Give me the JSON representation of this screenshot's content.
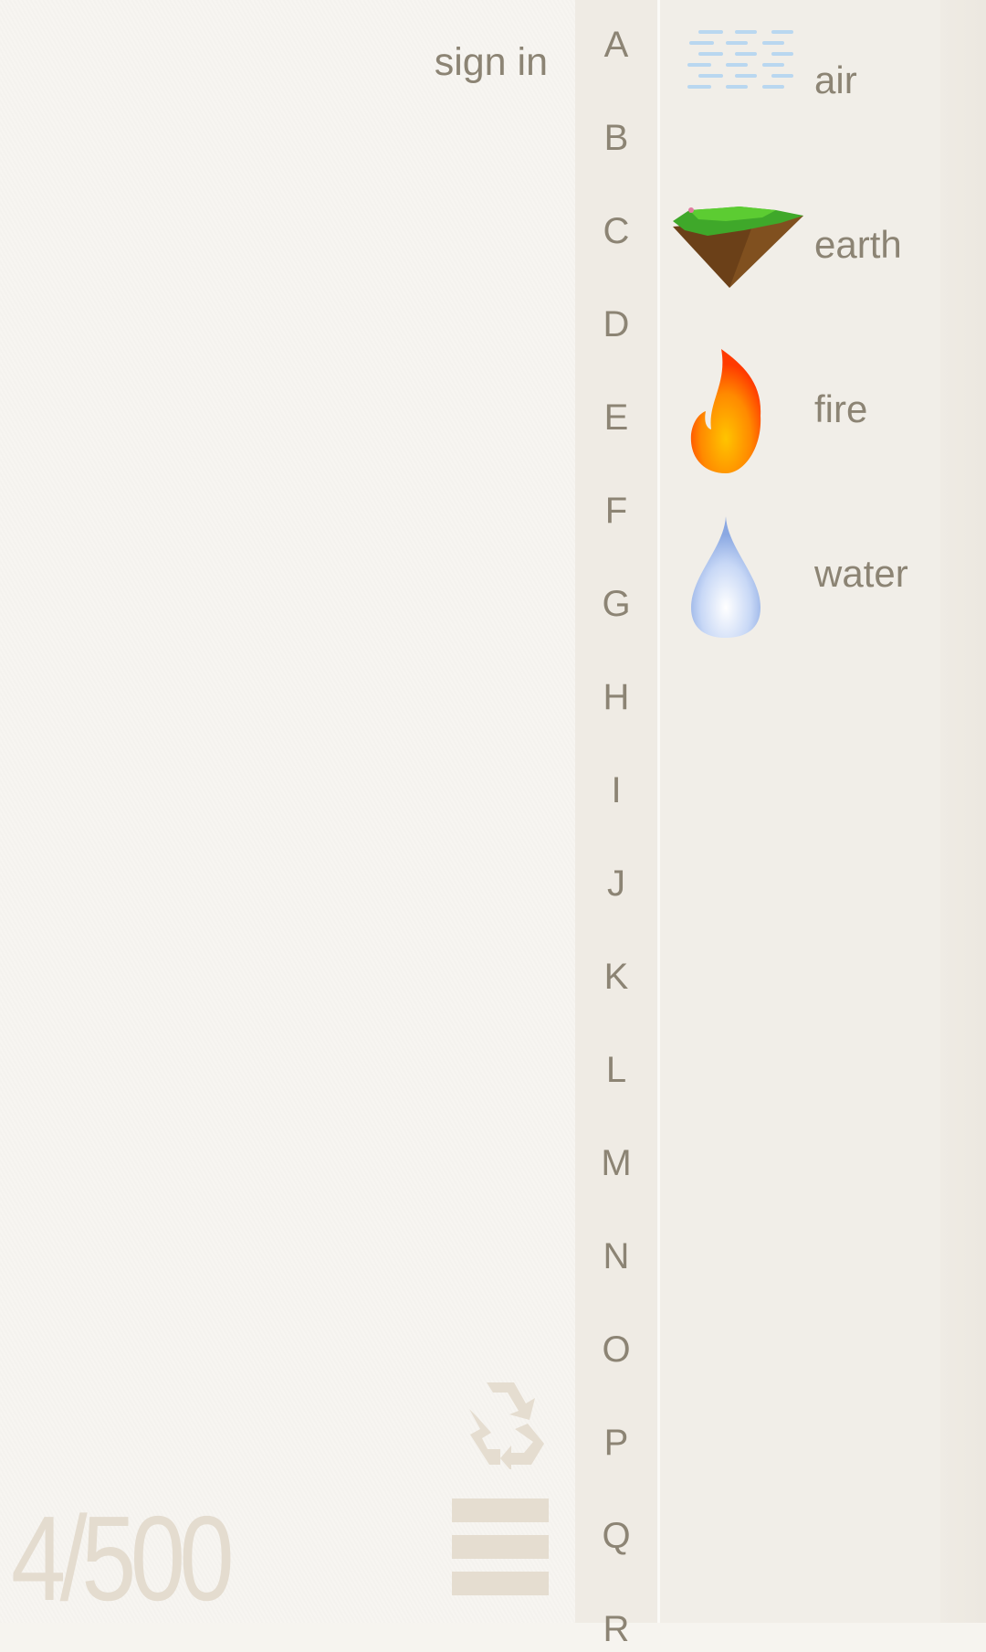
{
  "header": {
    "sign_in_label": "sign in"
  },
  "alphabet": [
    "A",
    "B",
    "C",
    "D",
    "E",
    "F",
    "G",
    "H",
    "I",
    "J",
    "K",
    "L",
    "M",
    "N",
    "O",
    "P",
    "Q",
    "R"
  ],
  "elements": [
    {
      "name": "air",
      "icon": "air-icon"
    },
    {
      "name": "earth",
      "icon": "earth-icon"
    },
    {
      "name": "fire",
      "icon": "fire-icon"
    },
    {
      "name": "water",
      "icon": "water-icon"
    }
  ],
  "footer": {
    "counter": "4/500",
    "recycle_icon": "recycle-icon",
    "menu_icon": "hamburger-menu-icon"
  },
  "colors": {
    "text": "#8c8474",
    "muted": "#e4dccf",
    "background": "#f6f4ef"
  }
}
